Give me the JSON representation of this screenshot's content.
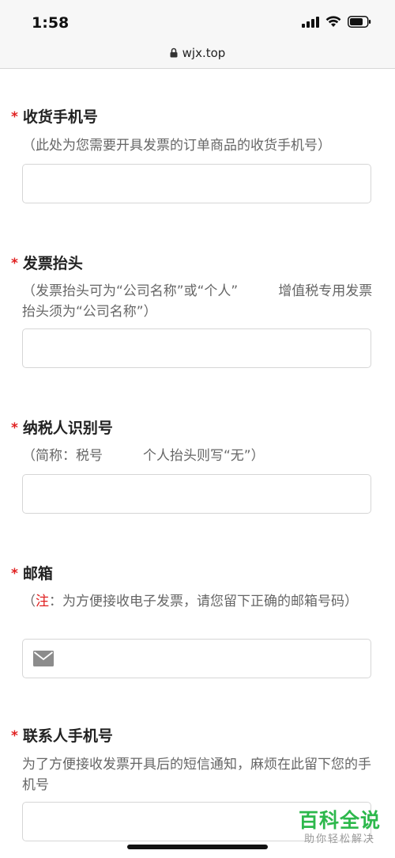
{
  "status": {
    "time": "1:58"
  },
  "browser": {
    "url": "wjx.top"
  },
  "form": {
    "questions": [
      {
        "required_mark": "*",
        "title": "收货手机号",
        "hint": "（此处为您需要开具发票的订单商品的收货手机号）"
      },
      {
        "required_mark": "*",
        "title": "发票抬头",
        "hint": "（发票抬头可为“公司名称”或“个人”　　　增值税专用发票抬头须为“公司名称”）"
      },
      {
        "required_mark": "*",
        "title": "纳税人识别号",
        "hint": "（简称：税号　　　个人抬头则写“无”）"
      },
      {
        "required_mark": "*",
        "title": "邮箱",
        "hint_prefix": "（",
        "hint_note": "注",
        "hint_rest": "：为方便接收电子发票，请您留下正确的邮箱号码）"
      },
      {
        "required_mark": "*",
        "title": "联系人手机号",
        "hint": "为了方便接收发票开具后的短信通知，麻烦在此留下您的手机号"
      }
    ]
  },
  "watermark": {
    "title": "百科全说",
    "subtitle": "助你轻松解决"
  },
  "icons": {
    "lock": "lock-icon",
    "signal": "signal-icon",
    "wifi": "wifi-icon",
    "battery": "battery-icon",
    "mail": "mail-icon"
  },
  "colors": {
    "required": "#e02020",
    "watermark": "#2db84c"
  }
}
